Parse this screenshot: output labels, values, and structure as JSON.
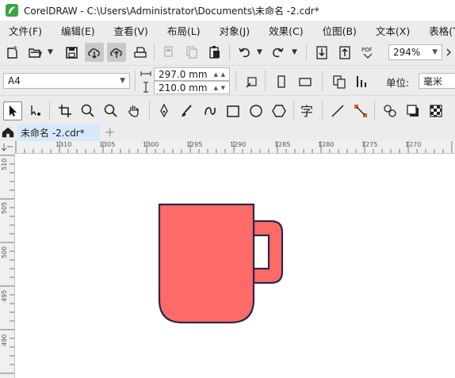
{
  "window": {
    "title": "CorelDRAW - C:\\Users\\Administrator\\Documents\\未命名 -2.cdr*",
    "logo_color": "#3aa545"
  },
  "menu": [
    "文件(F)",
    "编辑(E)",
    "查看(V)",
    "布局(L)",
    "对象(J)",
    "效果(C)",
    "位图(B)",
    "文本(X)",
    "表格(T)"
  ],
  "toolbar": {
    "zoom": "294%"
  },
  "propertybar": {
    "page_size": "A4",
    "width": "297.0 mm",
    "height": "210.0 mm",
    "units_label": "单位:",
    "units_value": "毫米"
  },
  "tabs": {
    "active": "未命名 -2.cdr*",
    "add": "+"
  },
  "ruler": {
    "h_labels": [
      "1310",
      "1305",
      "1300",
      "1295",
      "1290",
      "1285",
      "1280",
      "1275",
      "1270"
    ],
    "v_labels": [
      "510",
      "505",
      "500",
      "495",
      "490"
    ]
  },
  "drawing": {
    "mug_fill": "#fe6a68",
    "mug_stroke": "#282a4a"
  },
  "icons": [
    "new-icon",
    "open-icon",
    "save-icon",
    "cloud-download-icon",
    "cloud-upload-icon",
    "print-icon",
    "cut-icon",
    "copy-icon",
    "paste-icon",
    "undo-icon",
    "redo-icon",
    "import-icon",
    "export-icon",
    "pdf-icon",
    "home-icon"
  ]
}
